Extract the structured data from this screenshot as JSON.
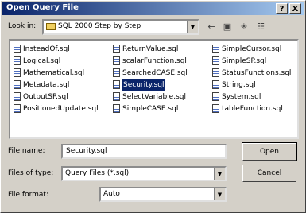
{
  "titlebar": {
    "title": "Open Query File",
    "help_label": "?",
    "close_label": "X"
  },
  "look_in": {
    "label": "Look in:",
    "value": "SQL 2000 Step by Step"
  },
  "toolbar": {
    "back_icon": "back-arrow-icon",
    "up_icon": "up-folder-icon",
    "new_folder_icon": "new-folder-icon",
    "views_icon": "views-menu-icon"
  },
  "files": {
    "column1": [
      "InsteadOf.sql",
      "Logical.sql",
      "Mathematical.sql",
      "Metadata.sql",
      "OutputSP.sql",
      "PositionedUpdate.sql"
    ],
    "column2": [
      "ReturnValue.sql",
      "scalarFunction.sql",
      "SearchedCASE.sql",
      "Security.sql",
      "SelectVariable.sql",
      "SimpleCASE.sql"
    ],
    "column3": [
      "SimpleCursor.sql",
      "SimpleSP.sql",
      "StatusFunctions.sql",
      "String.sql",
      "System.sql",
      "tableFunction.sql"
    ],
    "selected": "Security.sql"
  },
  "file_name": {
    "label": "File name:",
    "value": "Security.sql"
  },
  "files_of_type": {
    "label": "Files of type:",
    "value": "Query Files (*.sql)"
  },
  "file_format": {
    "label": "File format:",
    "value": "Auto"
  },
  "buttons": {
    "open": "Open",
    "cancel": "Cancel"
  }
}
